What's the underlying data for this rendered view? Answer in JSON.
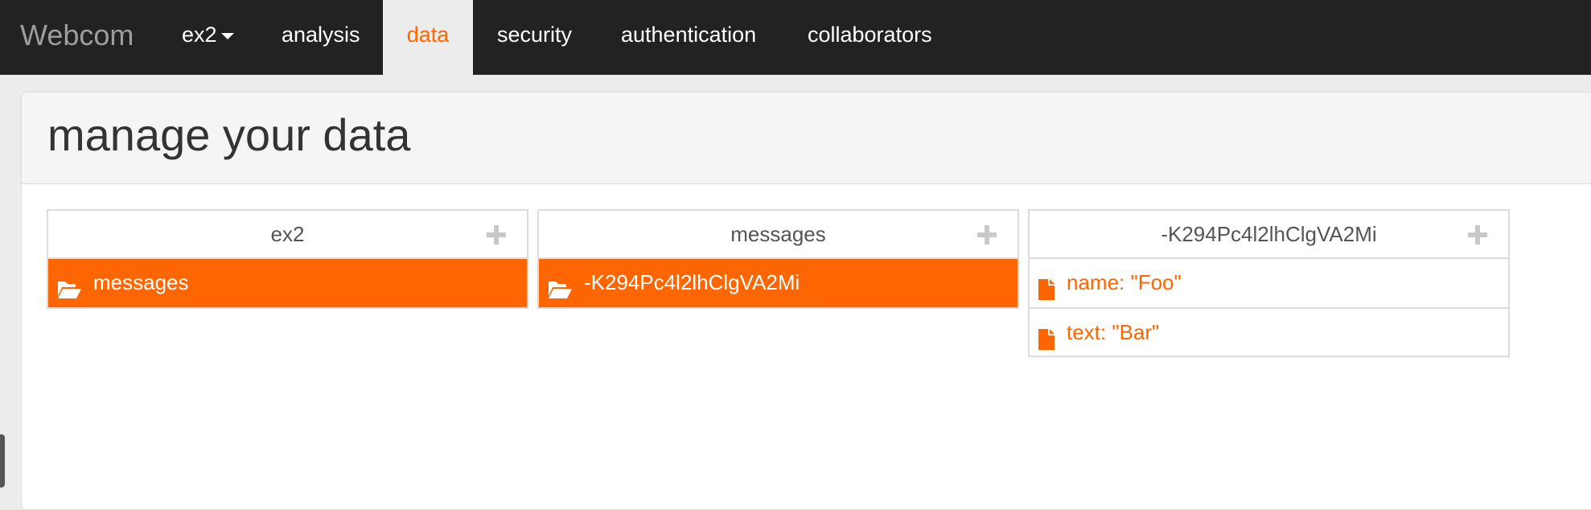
{
  "navbar": {
    "brand": "Webcom",
    "app_dropdown": "ex2",
    "tabs": [
      {
        "label": "analysis"
      },
      {
        "label": "data"
      },
      {
        "label": "security"
      },
      {
        "label": "authentication"
      },
      {
        "label": "collaborators"
      }
    ],
    "active_tab": "data"
  },
  "panel": {
    "title": "manage your data"
  },
  "columns": [
    {
      "header": "ex2",
      "rows": [
        {
          "label": "messages",
          "type": "folder",
          "selected": true
        }
      ]
    },
    {
      "header": "messages",
      "rows": [
        {
          "label": "-K294Pc4l2lhClgVA2Mi",
          "type": "folder",
          "selected": true
        }
      ]
    },
    {
      "header": "-K294Pc4l2lhClgVA2Mi",
      "rows": [
        {
          "label": "name: \"Foo\"",
          "type": "file",
          "selected": false
        },
        {
          "label": "text: \"Bar\"",
          "type": "file",
          "selected": false
        }
      ]
    }
  ],
  "colors": {
    "accent": "#ff6600",
    "navbar_bg": "#222222",
    "page_bg": "#ececec"
  },
  "icons": {
    "folder": "folder-open-icon",
    "file": "file-icon",
    "add": "plus-icon"
  }
}
